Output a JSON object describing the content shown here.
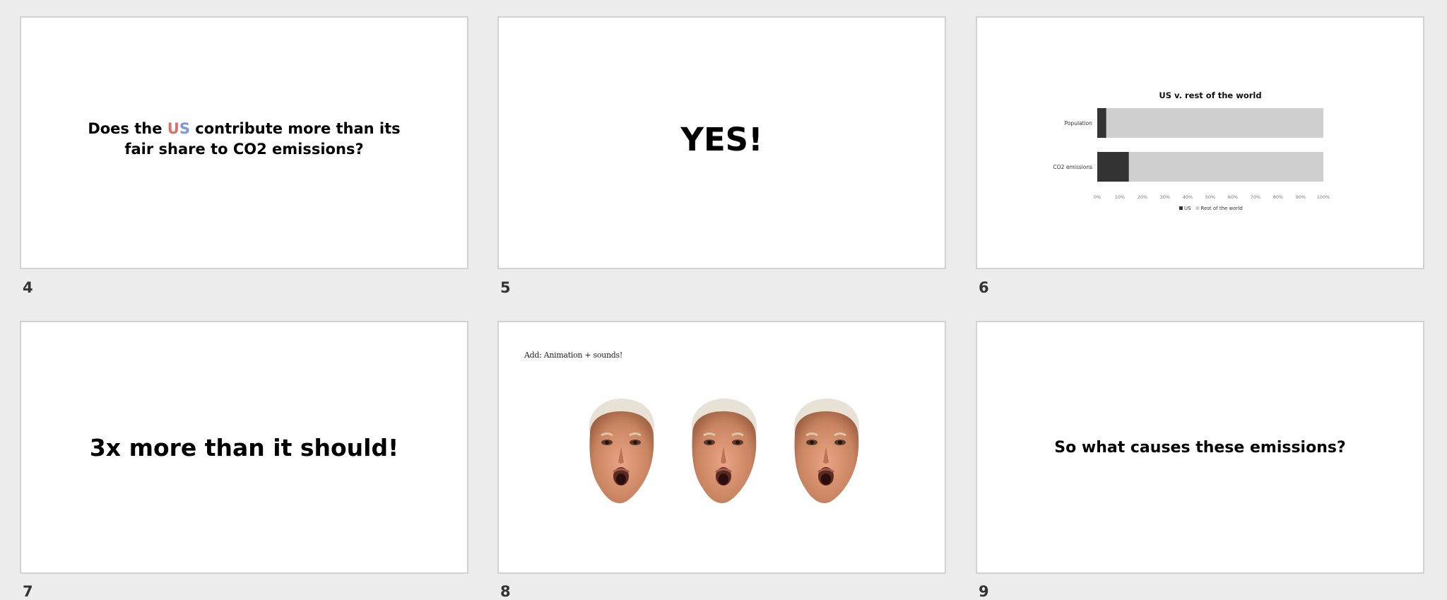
{
  "slides": [
    {
      "number": "4",
      "title_before": "Does the ",
      "title_us_u": "U",
      "title_us_s": "S",
      "title_after": " contribute more than its fair share to CO2 emissions?",
      "colors": {
        "u": "#d9716a",
        "s": "#7b98dd"
      }
    },
    {
      "number": "5",
      "text": "YES!"
    },
    {
      "number": "6"
    },
    {
      "number": "7",
      "text": "3x more than it should!"
    },
    {
      "number": "8",
      "note": "Add: Animation + sounds!",
      "image_icon": "face-image"
    },
    {
      "number": "9",
      "text": "So what causes these emissions?"
    }
  ],
  "chart_data": {
    "type": "bar",
    "orientation": "horizontal",
    "stacked": true,
    "title": "US v. rest of the world",
    "categories": [
      "Population",
      "CO2 emissions"
    ],
    "series": [
      {
        "name": "US",
        "values": [
          4,
          14
        ],
        "color": "#333333"
      },
      {
        "name": "Rest of the world",
        "values": [
          96,
          86
        ],
        "color": "#d0cfd0"
      }
    ],
    "xticks": [
      "0%",
      "10%",
      "20%",
      "30%",
      "40%",
      "50%",
      "60%",
      "70%",
      "80%",
      "90%",
      "100%"
    ],
    "xlim": [
      0,
      100
    ],
    "legend": "bottom"
  }
}
